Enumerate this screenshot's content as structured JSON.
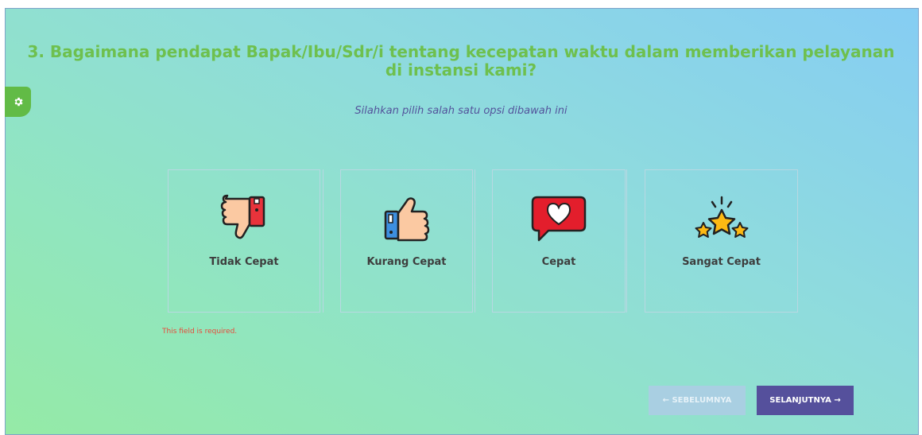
{
  "question": {
    "title": "3. Bagaimana pendapat Bapak/Ibu/Sdr/i tentang kecepatan waktu dalam memberikan pelayanan di instansi kami?",
    "instruction": "Silahkan pilih salah satu opsi dibawah ini"
  },
  "settings_tab": {
    "icon": "gear-icon"
  },
  "options": [
    {
      "label": "Tidak Cepat",
      "icon": "thumbs-down-icon"
    },
    {
      "label": "Kurang Cepat",
      "icon": "thumbs-up-icon"
    },
    {
      "label": "Cepat",
      "icon": "heart-speech-bubble-icon"
    },
    {
      "label": "Sangat Cepat",
      "icon": "stars-icon"
    }
  ],
  "validation": {
    "error": "This field is required."
  },
  "navigation": {
    "prev_label": "← SEBELUMNYA",
    "next_label": "SELANJUTNYA →"
  },
  "colors": {
    "title": "#6ec04e",
    "instruction": "#53539b",
    "error": "#e84a3a",
    "next_button": "#55509c",
    "prev_button": "#a9cfe2",
    "settings_tab": "#62bb46"
  }
}
